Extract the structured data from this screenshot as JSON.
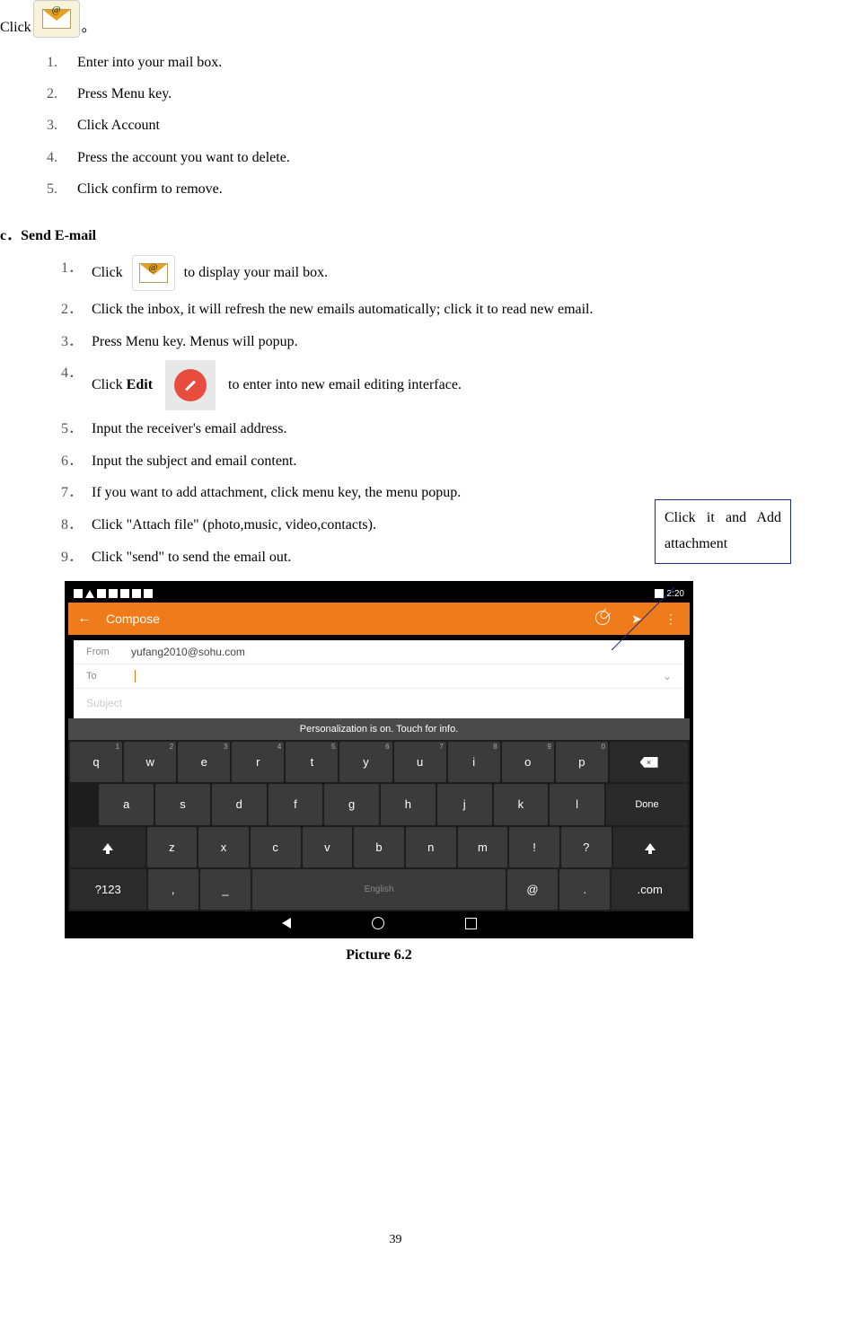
{
  "intro": {
    "prefix": "Click",
    "suffix": "。"
  },
  "list_a": [
    "Enter into your mail box.",
    "Press Menu key.",
    "Click Account",
    "Press the account you want to delete.",
    "Click confirm to remove."
  ],
  "section_c": {
    "letter": "c．",
    "title": "Send E-mail"
  },
  "list_c": {
    "item1_pre": "Click",
    "item1_post": " to display your mail box.",
    "item2": "Click the inbox, it will refresh the new emails automatically; click it to read new email.",
    "item3": "Press Menu key. Menus will popup.",
    "item4_pre": "Click ",
    "item4_bold": "Edit",
    "item4_post": " to enter into new email editing interface.",
    "item5": "Input the receiver's email address.",
    "item6": "Input the subject and email content.",
    "item7": "If you want to add attachment, click menu key, the menu popup.",
    "item8": "Click \"Attach file\" (photo,music, video,contacts).",
    "item9": "Click \"send\" to send the email out."
  },
  "callout": "Click it and Add attachment",
  "screenshot": {
    "status_time": "2:20",
    "appbar_title": "Compose",
    "from_label": "From",
    "from_value": "yufang2010@sohu.com",
    "to_label": "To",
    "subject_placeholder": "Subject",
    "toast": "Personalization is on. Touch for info.",
    "kb_row1": [
      "q",
      "w",
      "e",
      "r",
      "t",
      "y",
      "u",
      "i",
      "o",
      "p"
    ],
    "kb_row1_sup": [
      "1",
      "2",
      "3",
      "4",
      "5",
      "6",
      "7",
      "8",
      "9",
      "0"
    ],
    "kb_row2": [
      "a",
      "s",
      "d",
      "f",
      "g",
      "h",
      "j",
      "k",
      "l"
    ],
    "kb_row2_done": "Done",
    "kb_row3": [
      "z",
      "x",
      "c",
      "v",
      "b",
      "n",
      "m",
      "!",
      "?"
    ],
    "kb_row4_123": "?123",
    "kb_row4_comma": ",",
    "kb_row4_underscore": "_",
    "kb_row4_space": "English",
    "kb_row4_at": "@",
    "kb_row4_dot": ".",
    "kb_row4_com": ".com"
  },
  "caption": "Picture 6.2",
  "page_number": "39"
}
